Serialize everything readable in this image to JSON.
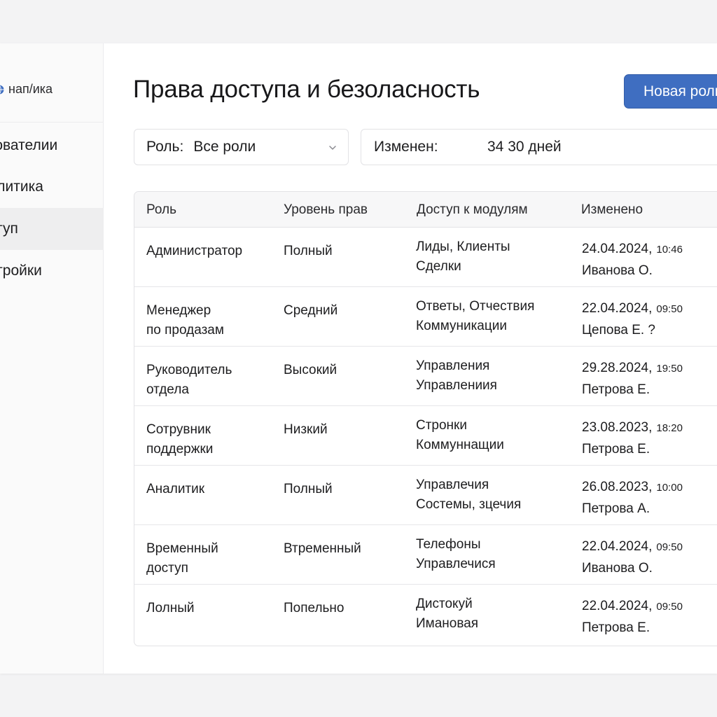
{
  "brand": {
    "name": "нап/ика",
    "icon": "globe-icon",
    "icon_color": "#3f6ec1"
  },
  "sidebar": {
    "items": [
      {
        "label": "ьзователии",
        "active": false
      },
      {
        "label": "налитика",
        "active": false
      },
      {
        "label": "оступ",
        "active": true
      },
      {
        "label": "астройки",
        "active": false
      }
    ]
  },
  "page": {
    "title": "Права доступа и безоласность"
  },
  "toolbar": {
    "new_role_label": "Новая роль",
    "accent_color": "#3f6ec1"
  },
  "filters": {
    "role": {
      "label": "Роль:",
      "value": "Все роли",
      "icon": "chevron-down-icon"
    },
    "changed": {
      "label": "Изменен:",
      "value": "34 30 дней"
    }
  },
  "table": {
    "columns": [
      "Роль",
      "Уровень прав",
      "Доступ к модулям",
      "Изменено"
    ],
    "rows": [
      {
        "role": [
          "Администратор",
          ""
        ],
        "level": "Полный",
        "modules": [
          "Лиды, Клиенты",
          "Сделки"
        ],
        "date": "24.04.2024,",
        "time": "10:46",
        "author": "Иванова О."
      },
      {
        "role": [
          "Менеджер",
          "по продазам"
        ],
        "level": "Средний",
        "modules": [
          "Ответы, Отчествия",
          "Коммуникации"
        ],
        "date": "22.04.2024,",
        "time": "09:50",
        "author": "Цепова Е. ?"
      },
      {
        "role": [
          "Руководитель",
          "отдела"
        ],
        "level": "Высокий",
        "modules": [
          "Управления",
          "Управлениия"
        ],
        "date": "29.28.2024,",
        "time": "19:50",
        "author": "Петрова Е."
      },
      {
        "role": [
          "Сотрувник",
          "поддержки"
        ],
        "level": "Низкий",
        "modules": [
          "Стронки",
          "Коммуннащии"
        ],
        "date": "23.08.2023,",
        "time": "18:20",
        "author": "Петрова Е."
      },
      {
        "role": [
          "Аналитик",
          ""
        ],
        "level": "Полный",
        "modules": [
          "Управлечия",
          "Состемы, зцечия"
        ],
        "date": "26.08.2023,",
        "time": "10:00",
        "author": "Петрова А."
      },
      {
        "role": [
          "Временный",
          "доступ"
        ],
        "level": "Втременный",
        "modules": [
          "Телефоны",
          "Управлечися"
        ],
        "date": "22.04.2024,",
        "time": "09:50",
        "author": "Иванова О."
      },
      {
        "role": [
          "Лолный",
          ""
        ],
        "level": "Попельно",
        "modules": [
          "Дистокуй",
          "Имановая"
        ],
        "date": "22.04.2024,",
        "time": "09:50",
        "author": "Петрова Е."
      }
    ]
  }
}
